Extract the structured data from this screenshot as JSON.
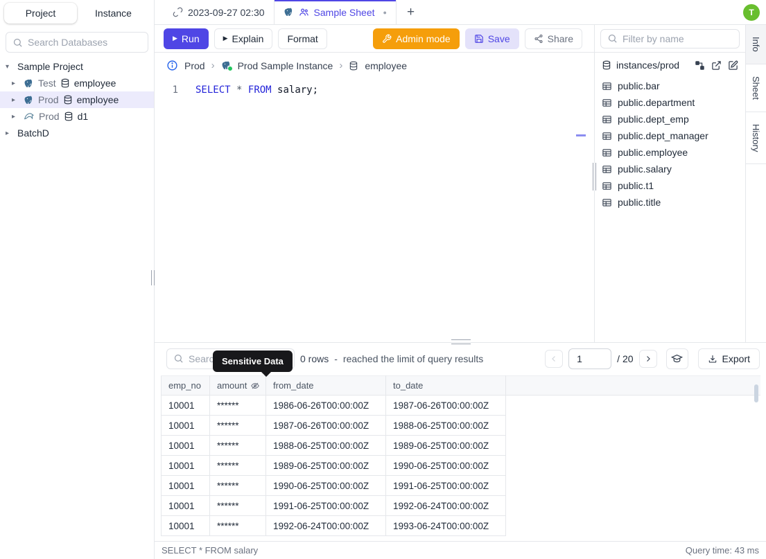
{
  "colors": {
    "accent": "#4f46e5",
    "admin_orange": "#f59e0b",
    "avatar_green": "#68be2e",
    "keyword_blue": "#2323d9",
    "tooltip_bg": "#18181b",
    "selected_row_bg": "#ecebfc"
  },
  "sidebar": {
    "tabs": {
      "project": "Project",
      "instance": "Instance"
    },
    "search_placeholder": "Search Databases",
    "tree": {
      "root1": "Sample Project",
      "items": [
        {
          "env": "Test",
          "db": "employee",
          "engine": "postgres"
        },
        {
          "env": "Prod",
          "db": "employee",
          "engine": "postgres"
        },
        {
          "env": "Prod",
          "db": "d1",
          "engine": "mysql"
        }
      ],
      "root2": "BatchD"
    }
  },
  "tabbar": {
    "tab1": "2023-09-27 02:30",
    "tab2": "Sample Sheet",
    "unsaved_dot": "●",
    "new_tab": "+",
    "avatar_initial": "T"
  },
  "toolbar": {
    "run": "Run",
    "explain": "Explain",
    "format": "Format",
    "admin_mode": "Admin mode",
    "save": "Save",
    "share": "Share",
    "play_glyph": "▶"
  },
  "breadcrumb": {
    "env": "Prod",
    "instance": "Prod Sample Instance",
    "database": "employee",
    "separator": "›"
  },
  "editor": {
    "line_number": "1",
    "kw1": "SELECT",
    "star": "*",
    "kw2": "FROM",
    "rest": " salary;"
  },
  "right_panel": {
    "filter_placeholder": "Filter by name",
    "connection": "instances/prod",
    "tables": [
      "public.bar",
      "public.department",
      "public.dept_emp",
      "public.dept_manager",
      "public.employee",
      "public.salary",
      "public.t1",
      "public.title"
    ]
  },
  "side_tabs": {
    "info": "Info",
    "sheet": "Sheet",
    "history": "History"
  },
  "results": {
    "search_placeholder": "Search",
    "tooltip": "Sensitive Data",
    "rows_count": "0 rows",
    "dash": "-",
    "limit_text": "reached the limit of query results",
    "page_value": "1",
    "page_total": "/ 20",
    "export": "Export",
    "columns": [
      "emp_no",
      "amount",
      "from_date",
      "to_date"
    ],
    "masked_column": "amount",
    "rows": [
      [
        "10001",
        "******",
        "1986-06-26T00:00:00Z",
        "1987-06-26T00:00:00Z"
      ],
      [
        "10001",
        "******",
        "1987-06-26T00:00:00Z",
        "1988-06-25T00:00:00Z"
      ],
      [
        "10001",
        "******",
        "1988-06-25T00:00:00Z",
        "1989-06-25T00:00:00Z"
      ],
      [
        "10001",
        "******",
        "1989-06-25T00:00:00Z",
        "1990-06-25T00:00:00Z"
      ],
      [
        "10001",
        "******",
        "1990-06-25T00:00:00Z",
        "1991-06-25T00:00:00Z"
      ],
      [
        "10001",
        "******",
        "1991-06-25T00:00:00Z",
        "1992-06-24T00:00:00Z"
      ],
      [
        "10001",
        "******",
        "1992-06-24T00:00:00Z",
        "1993-06-24T00:00:00Z"
      ]
    ],
    "status_sql": "SELECT * FROM salary",
    "query_time": "Query time: 43 ms"
  }
}
